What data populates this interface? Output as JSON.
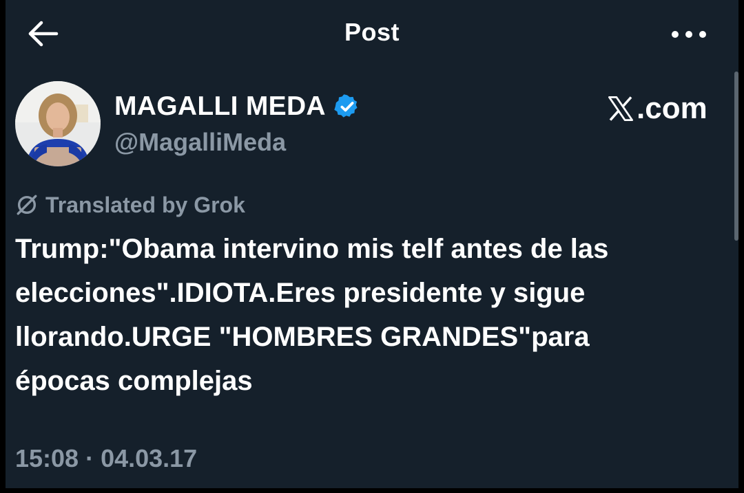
{
  "header": {
    "title": "Post",
    "back_icon": "arrow-left-icon",
    "more_icon": "ellipsis-icon"
  },
  "author": {
    "name": "MAGALLI MEDA",
    "handle": "@MagalliMeda",
    "verified_icon": "verified-badge-icon",
    "verified_color": "#1d9bf0"
  },
  "watermark": {
    "text": ".com",
    "logo": "x-logo-icon"
  },
  "translation": {
    "label": "Translated by Grok",
    "icon": "grok-icon"
  },
  "post": {
    "text": "Trump:\"Obama intervino mis telf antes de las\nelecciones\".IDIOTA.Eres presidente y sigue\nllorando.URGE \"HOMBRES GRANDES\"para\népocas complejas",
    "timestamp": "15:08 · 04.03.17"
  },
  "colors": {
    "background": "#15202b",
    "text": "#ffffff",
    "secondary_text": "#8b98a5",
    "accent": "#1d9bf0"
  }
}
